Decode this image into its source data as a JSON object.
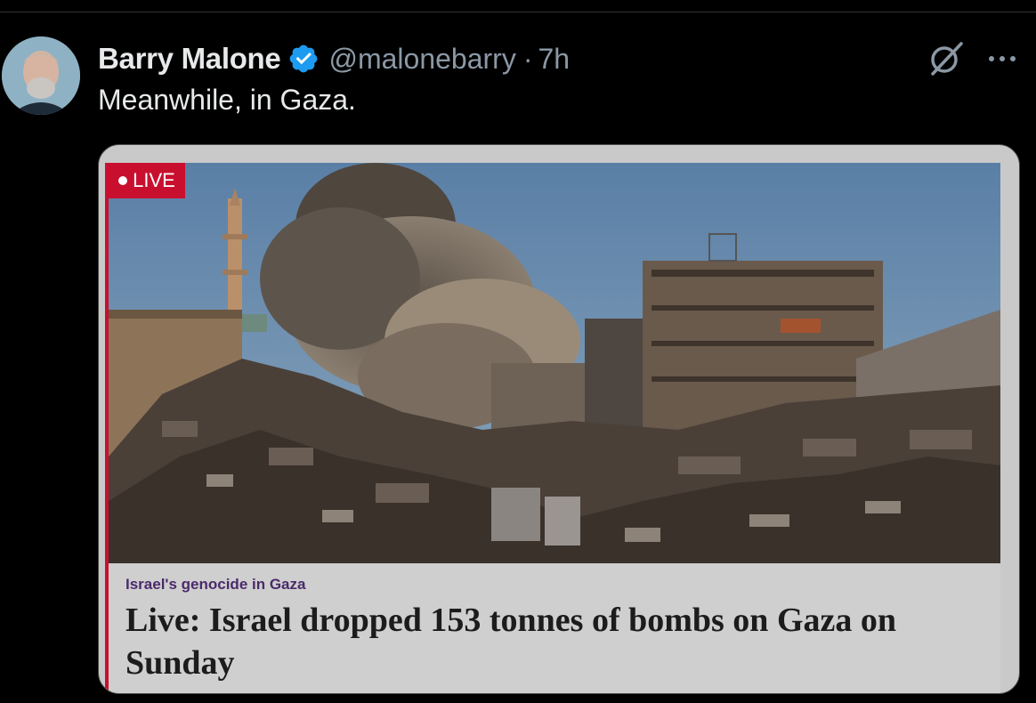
{
  "author": {
    "display_name": "Barry Malone",
    "handle": "@malonebarry",
    "separator": "·",
    "time_ago": "7h",
    "avatar_icon": "avatar-photo"
  },
  "tweet": {
    "text": "Meanwhile, in Gaza."
  },
  "icons": {
    "verified": "verified-badge-icon",
    "grok": "grok-icon",
    "more": "more-options-icon"
  },
  "card": {
    "badge_label": "LIVE",
    "kicker": "Israel's genocide in Gaza",
    "headline": "Live: Israel dropped 153 tonnes of bombs on Gaza on Sunday",
    "image_alt": "Smoke rising over destroyed buildings and rubble in Gaza"
  },
  "colors": {
    "background": "#000000",
    "verified_blue": "#1d9bf0",
    "live_red": "#c8102e",
    "kicker_purple": "#4b2a6b"
  }
}
